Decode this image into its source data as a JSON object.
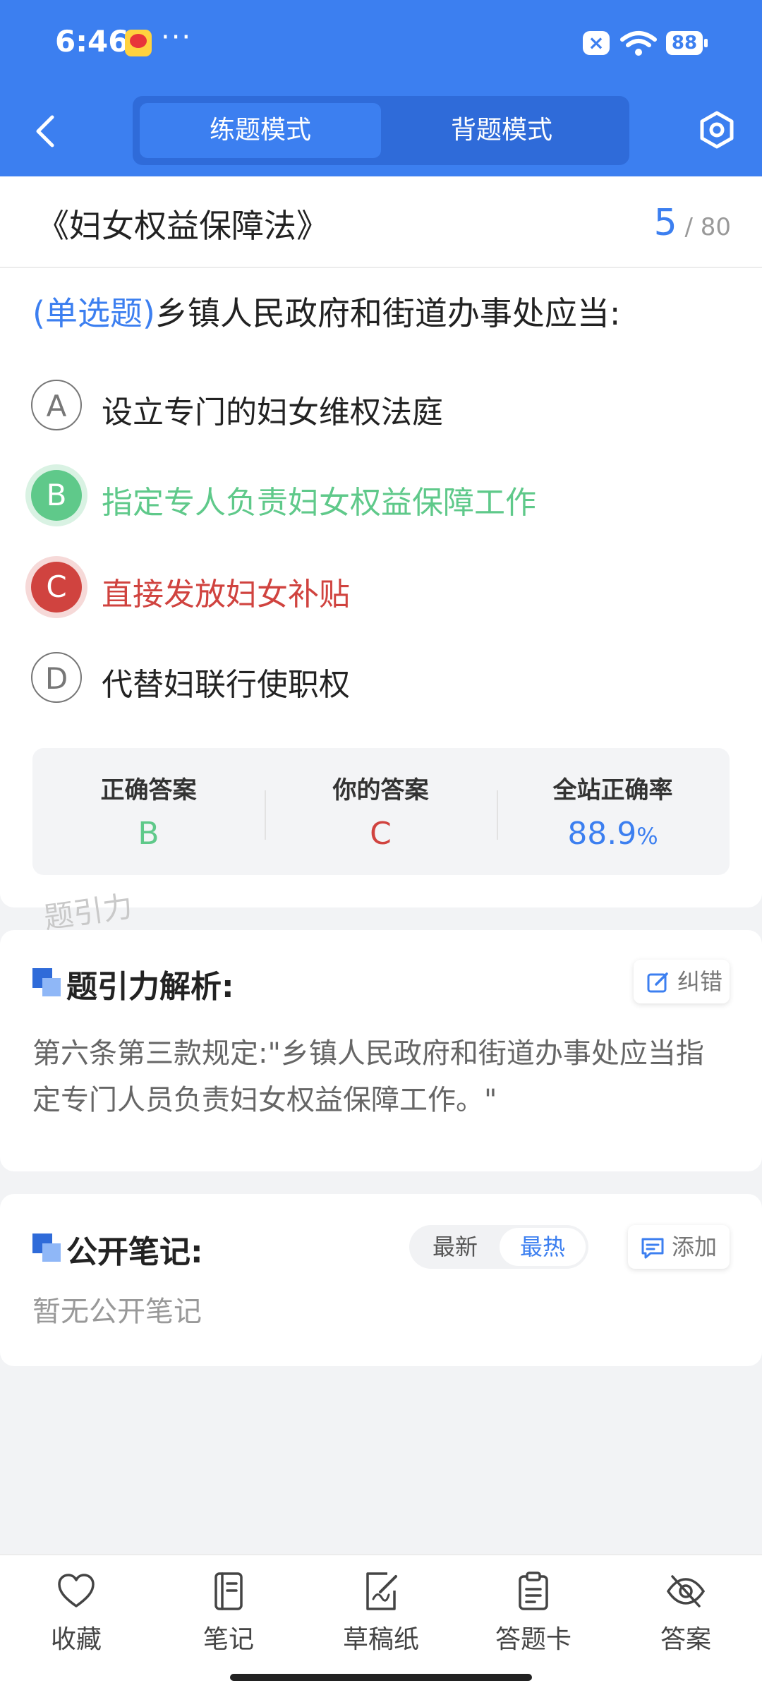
{
  "status_bar": {
    "time": "6:46",
    "dots": "···",
    "battery": "88"
  },
  "header": {
    "tabs": [
      {
        "label": "练题模式",
        "active": true
      },
      {
        "label": "背题模式",
        "active": false
      }
    ],
    "accent": "#3c7ff0"
  },
  "question": {
    "law_title": "《妇女权益保障法》",
    "current": "5",
    "total": "80",
    "type": "(单选题)",
    "text": "乡镇人民政府和街道办事处应当:",
    "options": [
      {
        "letter": "A",
        "text": "设立专门的妇女维权法庭",
        "state": "normal"
      },
      {
        "letter": "B",
        "text": "指定专人负责妇女权益保障工作",
        "state": "correct"
      },
      {
        "letter": "C",
        "text": "直接发放妇女补贴",
        "state": "wrong"
      },
      {
        "letter": "D",
        "text": "代替妇联行使职权",
        "state": "normal"
      }
    ]
  },
  "stats": {
    "correct_label": "正确答案",
    "correct_value": "B",
    "yours_label": "你的答案",
    "yours_value": "C",
    "rate_label": "全站正确率",
    "rate_value": "88.9",
    "rate_unit": "%"
  },
  "watermark": "题引力",
  "analysis": {
    "title": "题引力解析:",
    "report_label": "纠错",
    "text": "第六条第三款规定:\"乡镇人民政府和街道办事处应当指定专门人员负责妇女权益保障工作。\""
  },
  "notes": {
    "title": "公开笔记:",
    "sort_options": [
      "最新",
      "最热"
    ],
    "sort_active": "最热",
    "add_label": "添加",
    "empty_text": "暂无公开笔记"
  },
  "bottom_nav": [
    {
      "label": "收藏",
      "icon": "heart-icon"
    },
    {
      "label": "笔记",
      "icon": "notebook-icon"
    },
    {
      "label": "草稿纸",
      "icon": "draft-icon"
    },
    {
      "label": "答题卡",
      "icon": "clipboard-icon"
    },
    {
      "label": "答案",
      "icon": "eye-off-icon"
    }
  ],
  "colors": {
    "correct": "#5fc98a",
    "wrong": "#d0433f",
    "accent": "#3c7ff0"
  }
}
